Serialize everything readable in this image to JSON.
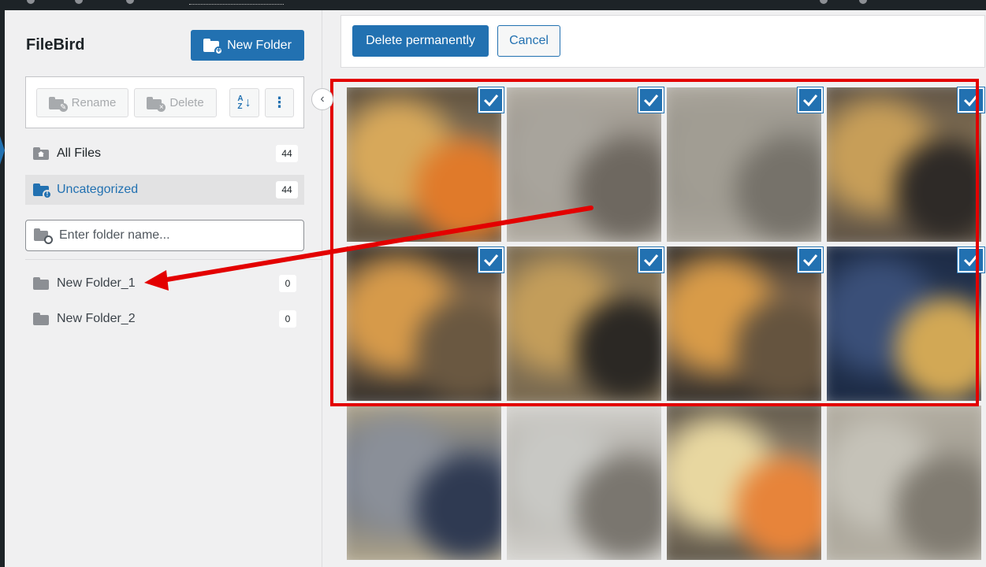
{
  "sidebar": {
    "title": "FileBird",
    "new_folder_label": "New Folder",
    "rename_label": "Rename",
    "delete_label": "Delete",
    "sort_glyph_top": "A",
    "sort_glyph_bottom": "Z",
    "more_glyph": "⋮",
    "nav": [
      {
        "label": "All Files",
        "count": "44",
        "icon": "home-folder-icon"
      },
      {
        "label": "Uncategorized",
        "count": "44",
        "icon": "uncategorized-folder-icon",
        "active": true
      }
    ],
    "search_placeholder": "Enter folder name...",
    "folders": [
      {
        "label": "New Folder_1",
        "count": "0"
      },
      {
        "label": "New Folder_2",
        "count": "0"
      }
    ]
  },
  "main": {
    "delete_permanently_label": "Delete permanently",
    "cancel_label": "Cancel",
    "thumbnails": [
      {
        "selected": true,
        "colors": [
          "#8a7a62",
          "#d7a85a",
          "#e07a2a",
          "#5b4d3a"
        ]
      },
      {
        "selected": true,
        "colors": [
          "#8e8880",
          "#a8a49c",
          "#6e6860",
          "#b7b2a8"
        ]
      },
      {
        "selected": true,
        "colors": [
          "#8a877f",
          "#a19d93",
          "#76726a",
          "#b1aca2"
        ]
      },
      {
        "selected": true,
        "colors": [
          "#8c7756",
          "#c79e58",
          "#2e2a27",
          "#5c5145"
        ]
      },
      {
        "selected": true,
        "colors": [
          "#9c7d5a",
          "#d69a4a",
          "#6a5841",
          "#2d2a27"
        ]
      },
      {
        "selected": true,
        "colors": [
          "#8d7959",
          "#c39d5a",
          "#2b2824",
          "#77684f"
        ]
      },
      {
        "selected": true,
        "colors": [
          "#97795a",
          "#d89b48",
          "#65543f",
          "#2d2a26"
        ]
      },
      {
        "selected": true,
        "colors": [
          "#243553",
          "#3a4f78",
          "#d2a855",
          "#1c2a44"
        ]
      },
      {
        "selected": false,
        "colors": [
          "#556077",
          "#8a8f98",
          "#2f3a52",
          "#b5a98c"
        ]
      },
      {
        "selected": false,
        "colors": [
          "#a09c95",
          "#c8c8c4",
          "#7a766f",
          "#d9d8d4"
        ]
      },
      {
        "selected": false,
        "colors": [
          "#9a8d7a",
          "#e8d7a0",
          "#e7843a",
          "#5c5446"
        ]
      },
      {
        "selected": false,
        "colors": [
          "#9e998e",
          "#c5c2b8",
          "#7f7a70",
          "#b6b1a5"
        ]
      }
    ]
  },
  "colors": {
    "accent": "#2271b1",
    "highlight": "#e30000"
  }
}
